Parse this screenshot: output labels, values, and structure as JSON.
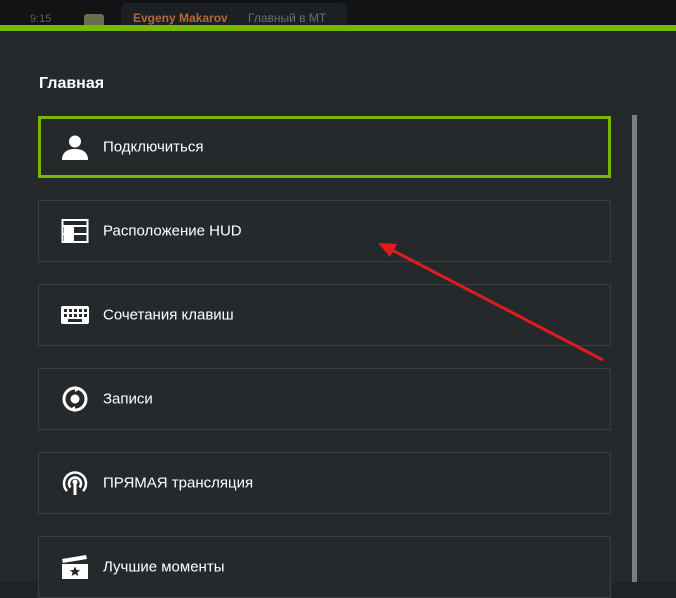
{
  "topbar": {
    "time": "9:15",
    "message_author": "Evgeny Makarov",
    "message_text": "Главный в МТ"
  },
  "section_title": "Главная",
  "menu": [
    {
      "label": "Подключиться",
      "icon": "user-icon",
      "selected": true
    },
    {
      "label": "Расположение HUD",
      "icon": "hud-layout-icon",
      "selected": false
    },
    {
      "label": "Сочетания клавиш",
      "icon": "keyboard-icon",
      "selected": false
    },
    {
      "label": "Записи",
      "icon": "recordings-icon",
      "selected": false
    },
    {
      "label": "ПРЯМАЯ трансляция",
      "icon": "broadcast-icon",
      "selected": false
    },
    {
      "label": "Лучшие моменты",
      "icon": "highlights-icon",
      "selected": false
    }
  ],
  "colors": {
    "accent": "#76b900",
    "panel_bg": "#26292c",
    "item_border": "#3a3e42",
    "annotation_arrow": "#e01b1b",
    "author": "#b06a3c"
  }
}
